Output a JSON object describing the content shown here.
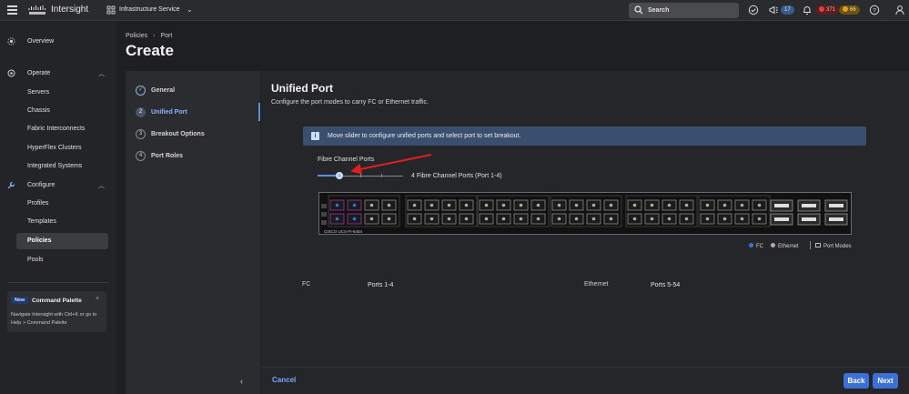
{
  "topbar": {
    "app_name": "Intersight",
    "service": "Infrastructure Service",
    "search_placeholder": "Search",
    "notifications_count": "17",
    "alarms_critical": "371",
    "alarms_warning": "66"
  },
  "sidebar": {
    "overview": "Overview",
    "operate": {
      "label": "Operate",
      "items": [
        "Servers",
        "Chassis",
        "Fabric Interconnects",
        "HyperFlex Clusters",
        "Integrated Systems"
      ]
    },
    "configure": {
      "label": "Configure",
      "items": [
        "Profiles",
        "Templates",
        "Policies",
        "Pools"
      ]
    },
    "active_item": "Policies",
    "command_palette": {
      "badge": "New",
      "title": "Command Palette",
      "desc": "Navigate Intersight with Ctrl+K or go to Help > Command Palette"
    }
  },
  "header": {
    "breadcrumb": [
      "Policies",
      "Port"
    ],
    "title": "Create"
  },
  "steps": [
    {
      "num": "✓",
      "label": "General",
      "state": "done"
    },
    {
      "num": "2",
      "label": "Unified Port",
      "state": "active"
    },
    {
      "num": "3",
      "label": "Breakout Options",
      "state": "pending"
    },
    {
      "num": "4",
      "label": "Port Roles",
      "state": "pending"
    }
  ],
  "main": {
    "title": "Unified Port",
    "subtitle": "Configure the port modes to carry FC or Ethernet traffic.",
    "info": "Move slider to configure unified ports and select port to set breakout.",
    "fc_title": "Fibre Channel Ports",
    "slider_value_text": "4 Fibre Channel Ports (Port 1-4)",
    "slider_fraction": 0.25,
    "switch_model": "CISCO UCS-FI-6454",
    "legend": {
      "fc": "FC",
      "ethernet": "Ethernet",
      "port_modes": "Port Modes"
    },
    "summary": {
      "fc_label": "FC",
      "fc_ports": "Ports 1-4",
      "eth_label": "Ethernet",
      "eth_ports": "Ports 5-54"
    }
  },
  "footer": {
    "cancel": "Cancel",
    "back": "Back",
    "next": "Next"
  },
  "colors": {
    "accent": "#3b70d6",
    "fc_port": "#3b70d6",
    "eth_port": "#b5a99a",
    "annotation": "#e02020"
  }
}
